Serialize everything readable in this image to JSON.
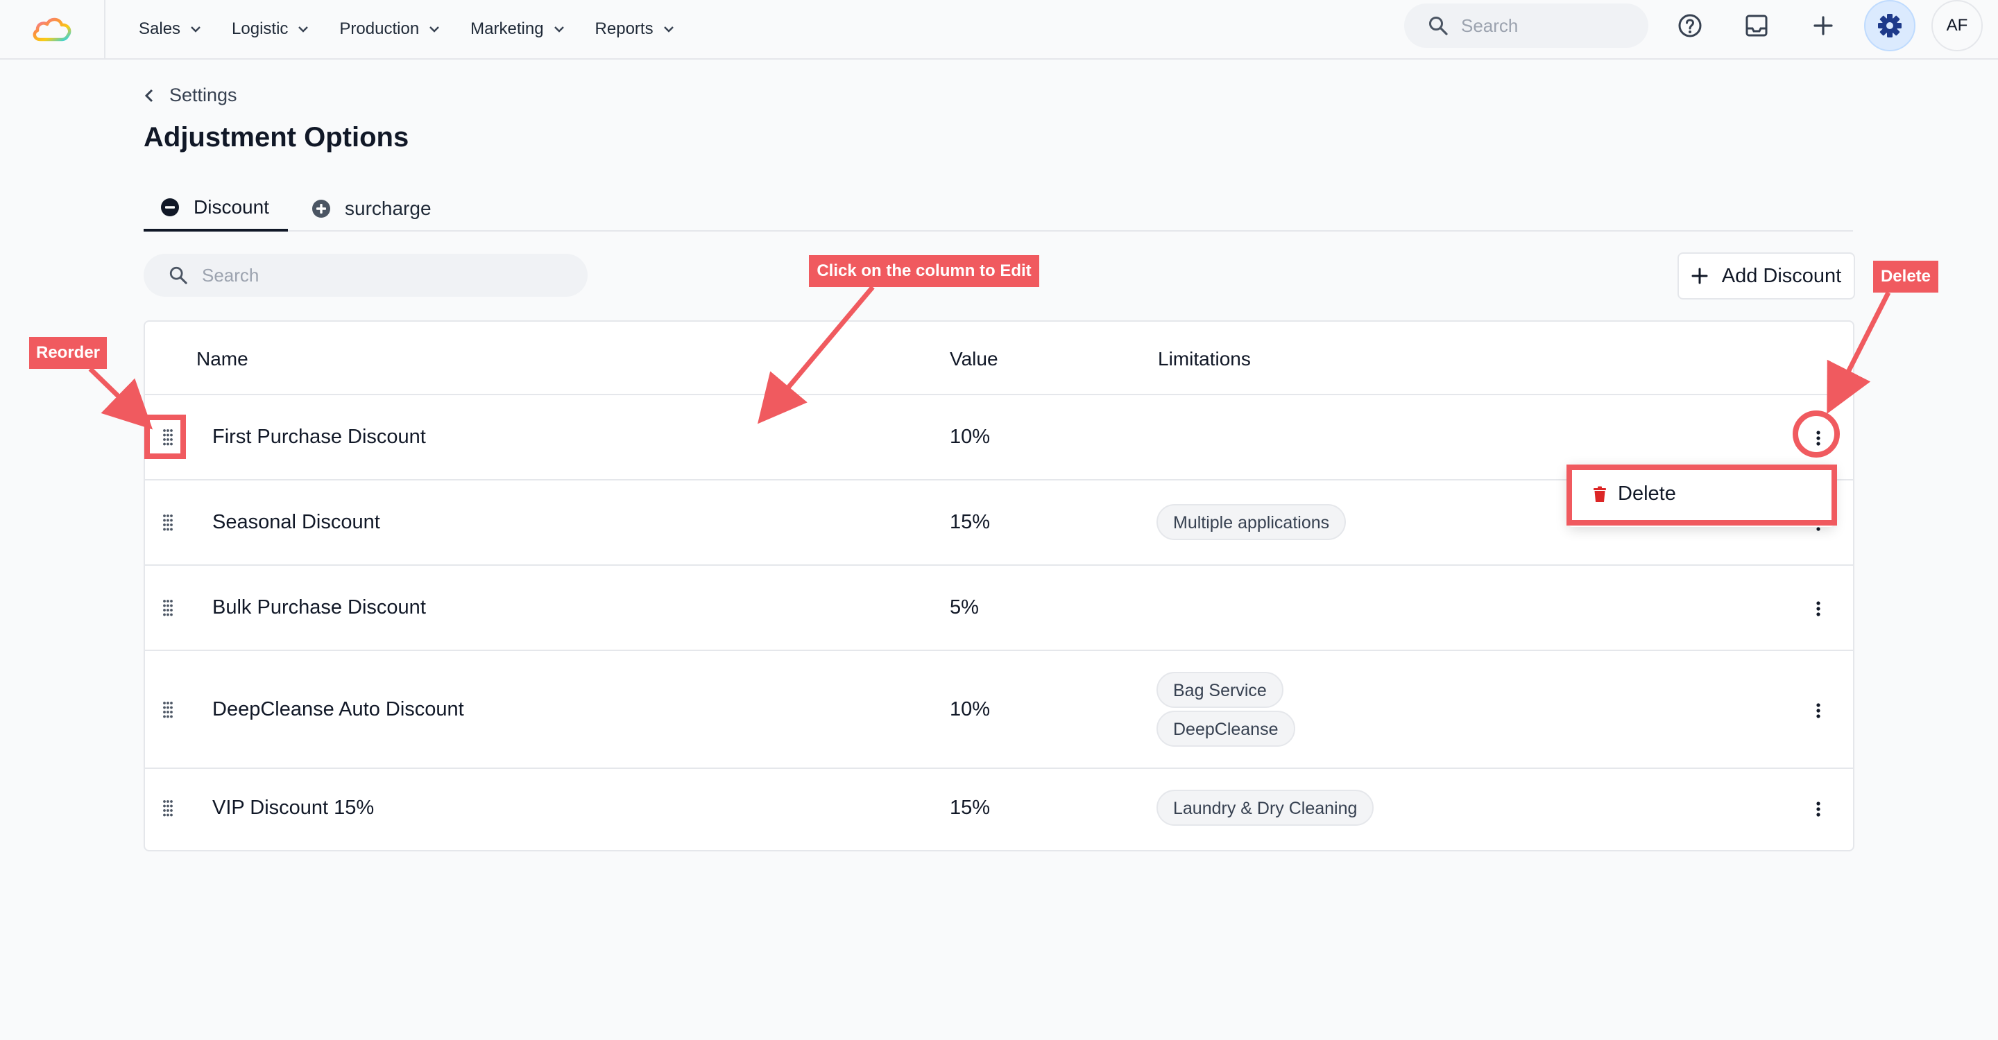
{
  "nav": {
    "items": [
      "Sales",
      "Logistic",
      "Production",
      "Marketing",
      "Reports"
    ],
    "search_placeholder": "Search",
    "avatar_initials": "AF"
  },
  "breadcrumb": {
    "label": "Settings"
  },
  "page": {
    "title": "Adjustment Options"
  },
  "tabs": [
    {
      "label": "Discount",
      "active": true,
      "icon": "minus-circle-icon"
    },
    {
      "label": "surcharge",
      "active": false,
      "icon": "plus-circle-icon"
    }
  ],
  "toolbar": {
    "search_placeholder": "Search",
    "add_label": "Add Discount"
  },
  "table": {
    "headers": [
      "Name",
      "Value",
      "Limitations"
    ],
    "rows": [
      {
        "name": "First Purchase Discount",
        "value": "10%",
        "limitations": []
      },
      {
        "name": "Seasonal Discount",
        "value": "15%",
        "limitations": [
          "Multiple applications"
        ]
      },
      {
        "name": "Bulk Purchase Discount",
        "value": "5%",
        "limitations": []
      },
      {
        "name": "DeepCleanse Auto Discount",
        "value": "10%",
        "limitations": [
          "Bag Service",
          "DeepCleanse"
        ]
      },
      {
        "name": "VIP Discount 15%",
        "value": "15%",
        "limitations": [
          "Laundry & Dry Cleaning"
        ]
      }
    ]
  },
  "row_menu": {
    "delete_label": "Delete"
  },
  "annotations": {
    "reorder": "Reorder",
    "edit": "Click on the column to Edit",
    "delete": "Delete",
    "color": "#f05a5f"
  }
}
